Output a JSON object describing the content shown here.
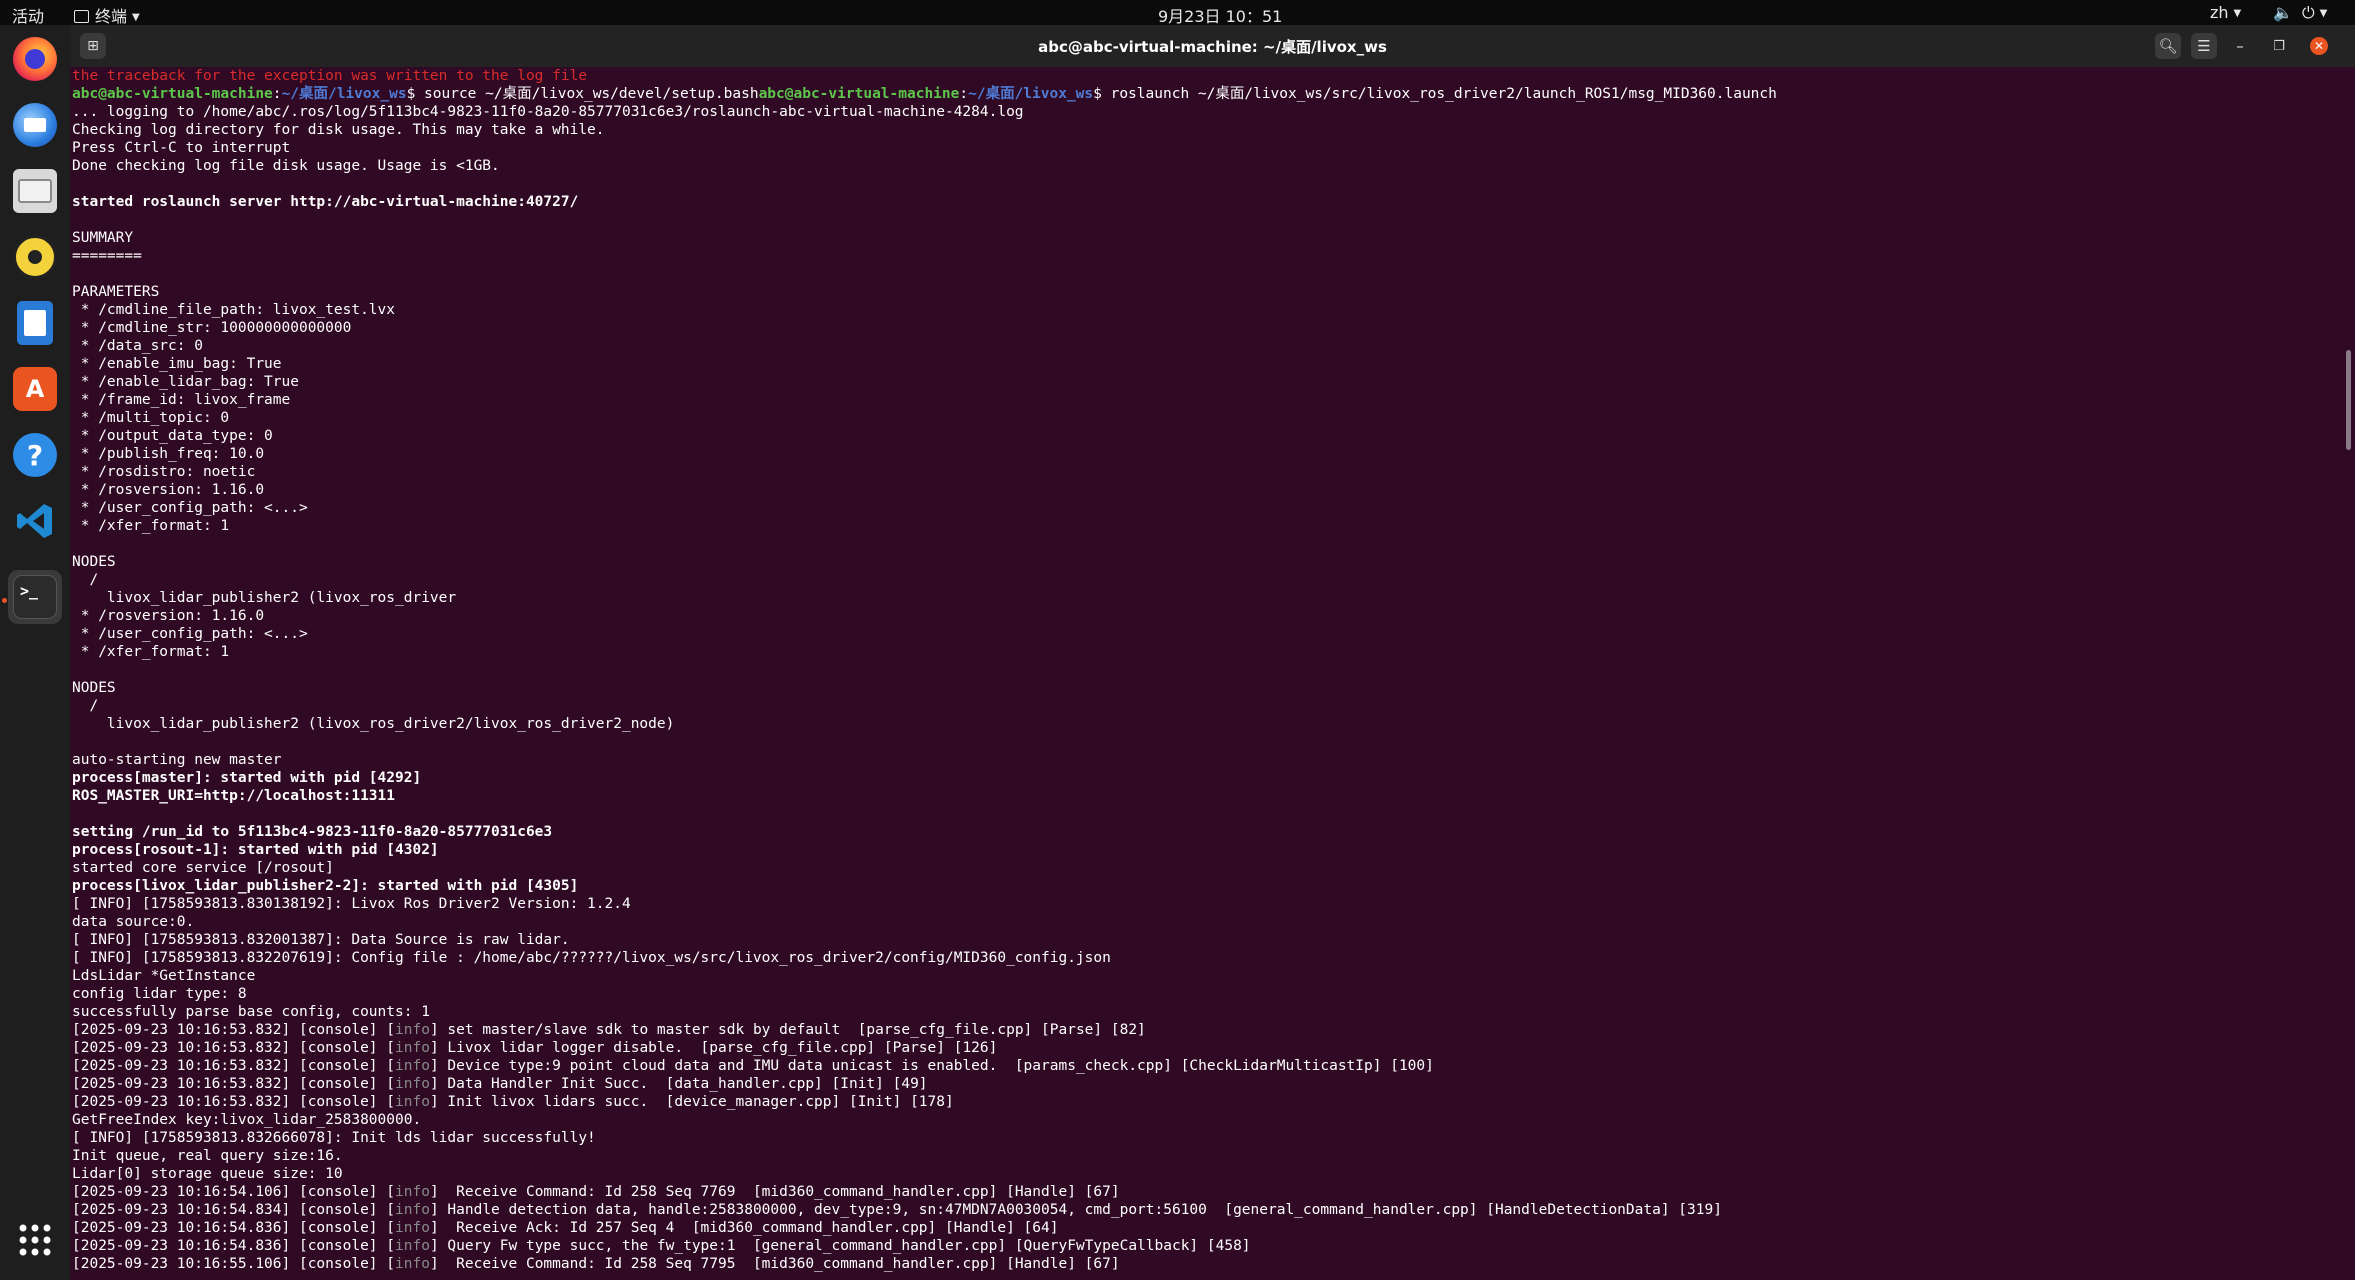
{
  "topbar": {
    "activities": "活动",
    "app_name": "终端",
    "datetime": "9月23日  10：51",
    "lang": "zh"
  },
  "dock": {
    "apps": [
      "firefox-icon",
      "thunderbird-icon",
      "files-icon",
      "rhythmbox-icon",
      "writer-icon",
      "app-center-icon",
      "help-icon",
      "vscode-icon",
      "terminal-icon"
    ],
    "accent": "#e95420"
  },
  "window": {
    "title": "abc@abc-virtual-machine: ~/桌面/livox_ws"
  },
  "terminal": {
    "lines": [
      [
        {
          "t": "the traceback for the exception was written to the log file",
          "c": "r"
        }
      ],
      [
        {
          "t": "abc@abc-virtual-machine",
          "c": "g"
        },
        {
          "t": ":"
        },
        {
          "t": "~/桌面/livox_ws",
          "c": "bl"
        },
        {
          "t": "$ source ~/桌面/livox_ws/devel/setup.bash"
        },
        {
          "t": "abc@abc-virtual-machine",
          "c": "g"
        },
        {
          "t": ":"
        },
        {
          "t": "~/桌面/livox_ws",
          "c": "bl"
        },
        {
          "t": "$ roslaunch ~/桌面/livox_ws/src/livox_ros_driver2/launch_ROS1/msg_MID360.launch"
        }
      ],
      [
        {
          "t": "... logging to /home/abc/.ros/log/5f113bc4-9823-11f0-8a20-85777031c6e3/roslaunch-abc-virtual-machine-4284.log"
        }
      ],
      [
        {
          "t": "Checking log directory for disk usage. This may take a while."
        }
      ],
      [
        {
          "t": "Press Ctrl-C to interrupt"
        }
      ],
      [
        {
          "t": "Done checking log file disk usage. Usage is <1GB."
        }
      ],
      [],
      [
        {
          "t": "started roslaunch server http://abc-virtual-machine:40727/",
          "c": "b"
        }
      ],
      [],
      [
        {
          "t": "SUMMARY"
        }
      ],
      [
        {
          "t": "========"
        }
      ],
      [],
      [
        {
          "t": "PARAMETERS"
        }
      ],
      [
        {
          "t": " * /cmdline_file_path: livox_test.lvx"
        }
      ],
      [
        {
          "t": " * /cmdline_str: 100000000000000"
        }
      ],
      [
        {
          "t": " * /data_src: 0"
        }
      ],
      [
        {
          "t": " * /enable_imu_bag: True"
        }
      ],
      [
        {
          "t": " * /enable_lidar_bag: True"
        }
      ],
      [
        {
          "t": " * /frame_id: livox_frame"
        }
      ],
      [
        {
          "t": " * /multi_topic: 0"
        }
      ],
      [
        {
          "t": " * /output_data_type: 0"
        }
      ],
      [
        {
          "t": " * /publish_freq: 10.0"
        }
      ],
      [
        {
          "t": " * /rosdistro: noetic"
        }
      ],
      [
        {
          "t": " * /rosversion: 1.16.0"
        }
      ],
      [
        {
          "t": " * /user_config_path: <...>"
        }
      ],
      [
        {
          "t": " * /xfer_format: 1"
        }
      ],
      [],
      [
        {
          "t": "NODES"
        }
      ],
      [
        {
          "t": "  /"
        }
      ],
      [
        {
          "t": "    livox_lidar_publisher2 (livox_ros_driver"
        }
      ],
      [
        {
          "t": " * /rosversion: 1.16.0"
        }
      ],
      [
        {
          "t": " * /user_config_path: <...>"
        }
      ],
      [
        {
          "t": " * /xfer_format: 1"
        }
      ],
      [],
      [
        {
          "t": "NODES"
        }
      ],
      [
        {
          "t": "  /"
        }
      ],
      [
        {
          "t": "    livox_lidar_publisher2 (livox_ros_driver2/livox_ros_driver2_node)"
        }
      ],
      [],
      [
        {
          "t": "auto-starting new master"
        }
      ],
      [
        {
          "t": "process[master]: started with pid [4292]",
          "c": "b"
        }
      ],
      [
        {
          "t": "ROS_MASTER_URI=http://localhost:11311",
          "c": "b"
        }
      ],
      [],
      [
        {
          "t": "setting /run_id to 5f113bc4-9823-11f0-8a20-85777031c6e3",
          "c": "b"
        }
      ],
      [
        {
          "t": "process[rosout-1]: started with pid [4302]",
          "c": "b"
        }
      ],
      [
        {
          "t": "started core service [/rosout]"
        }
      ],
      [
        {
          "t": "process[livox_lidar_publisher2-2]: started with pid [4305]",
          "c": "b"
        }
      ],
      [
        {
          "t": "[ INFO] [1758593813.830138192]: Livox Ros Driver2 Version: 1.2.4"
        }
      ],
      [
        {
          "t": "data source:0."
        }
      ],
      [
        {
          "t": "[ INFO] [1758593813.832001387]: Data Source is raw lidar."
        }
      ],
      [
        {
          "t": "[ INFO] [1758593813.832207619]: Config file : /home/abc/??????/livox_ws/src/livox_ros_driver2/config/MID360_config.json"
        }
      ],
      [
        {
          "t": "LdsLidar *GetInstance"
        }
      ],
      [
        {
          "t": "config lidar type: 8"
        }
      ],
      [
        {
          "t": "successfully parse base config, counts: 1"
        }
      ],
      [
        {
          "t": "[2025-09-23 10:16:53.832] [console] ["
        },
        {
          "t": "info",
          "c": "inf"
        },
        {
          "t": "] set master/slave sdk to master sdk by default  [parse_cfg_file.cpp] [Parse] [82]"
        }
      ],
      [
        {
          "t": "[2025-09-23 10:16:53.832] [console] ["
        },
        {
          "t": "info",
          "c": "inf"
        },
        {
          "t": "] Livox lidar logger disable.  [parse_cfg_file.cpp] [Parse] [126]"
        }
      ],
      [
        {
          "t": "[2025-09-23 10:16:53.832] [console] ["
        },
        {
          "t": "info",
          "c": "inf"
        },
        {
          "t": "] Device type:9 point cloud data and IMU data unicast is enabled.  [params_check.cpp] [CheckLidarMulticastIp] [100]"
        }
      ],
      [
        {
          "t": "[2025-09-23 10:16:53.832] [console] ["
        },
        {
          "t": "info",
          "c": "inf"
        },
        {
          "t": "] Data Handler Init Succ.  [data_handler.cpp] [Init] [49]"
        }
      ],
      [
        {
          "t": "[2025-09-23 10:16:53.832] [console] ["
        },
        {
          "t": "info",
          "c": "inf"
        },
        {
          "t": "] Init livox lidars succ.  [device_manager.cpp] [Init] [178]"
        }
      ],
      [
        {
          "t": "GetFreeIndex key:livox_lidar_2583800000."
        }
      ],
      [
        {
          "t": "[ INFO] [1758593813.832666078]: Init lds lidar successfully!"
        }
      ],
      [
        {
          "t": "Init queue, real query size:16."
        }
      ],
      [
        {
          "t": "Lidar[0] storage queue size: 10"
        }
      ],
      [
        {
          "t": "[2025-09-23 10:16:54.106] [console] ["
        },
        {
          "t": "info",
          "c": "inf"
        },
        {
          "t": "]  Receive Command: Id 258 Seq 7769  [mid360_command_handler.cpp] [Handle] [67]"
        }
      ],
      [
        {
          "t": "[2025-09-23 10:16:54.834] [console] ["
        },
        {
          "t": "info",
          "c": "inf"
        },
        {
          "t": "] Handle detection data, handle:2583800000, dev_type:9, sn:47MDN7A0030054, cmd_port:56100  [general_command_handler.cpp] [HandleDetectionData] [319]"
        }
      ],
      [
        {
          "t": "[2025-09-23 10:16:54.836] [console] ["
        },
        {
          "t": "info",
          "c": "inf"
        },
        {
          "t": "]  Receive Ack: Id 257 Seq 4  [mid360_command_handler.cpp] [Handle] [64]"
        }
      ],
      [
        {
          "t": "[2025-09-23 10:16:54.836] [console] ["
        },
        {
          "t": "info",
          "c": "inf"
        },
        {
          "t": "] Query Fw type succ, the fw_type:1  [general_command_handler.cpp] [QueryFwTypeCallback] [458]"
        }
      ],
      [
        {
          "t": "[2025-09-23 10:16:55.106] [console] ["
        },
        {
          "t": "info",
          "c": "inf"
        },
        {
          "t": "]  Receive Command: Id 258 Seq 7795  [mid360_command_handler.cpp] [Handle] [67]"
        }
      ]
    ]
  }
}
